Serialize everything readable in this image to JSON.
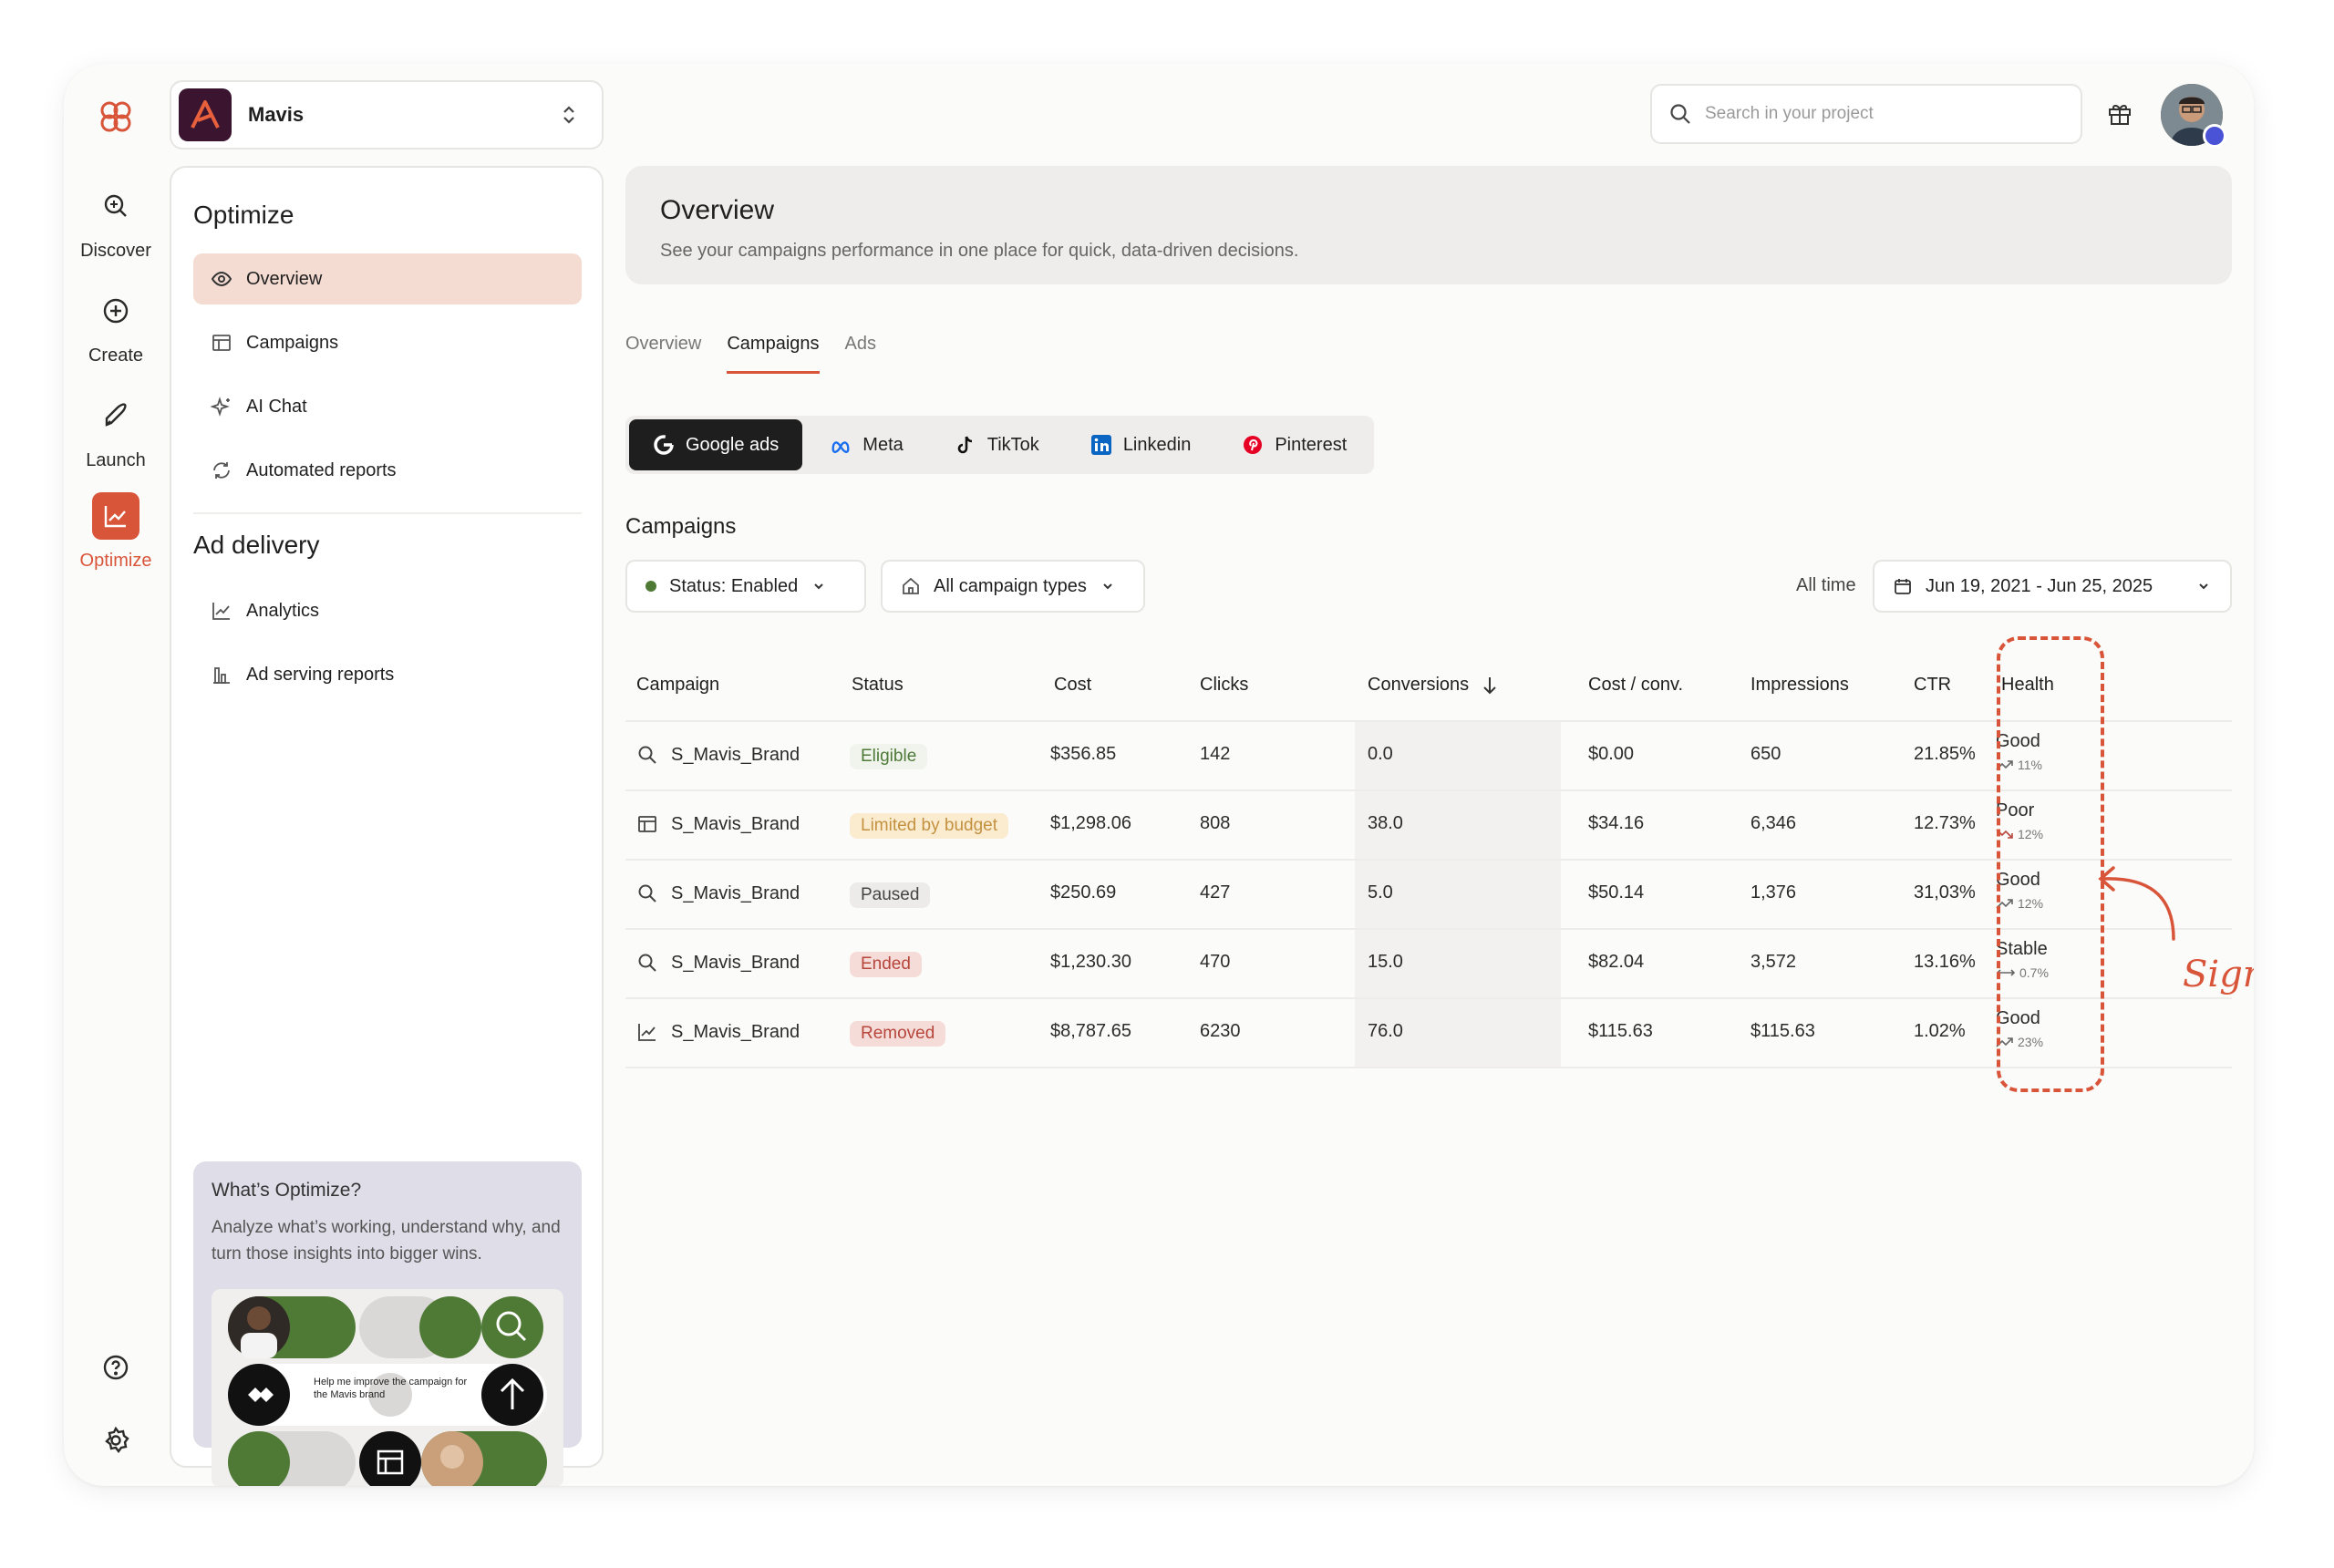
{
  "project": {
    "name": "Mavis"
  },
  "rail": {
    "items": [
      {
        "label": "Discover",
        "icon": "discover-icon"
      },
      {
        "label": "Create",
        "icon": "plus-circle-icon"
      },
      {
        "label": "Launch",
        "icon": "rocket-icon"
      },
      {
        "label": "Optimize",
        "icon": "chart-sparkle-icon",
        "active": true
      }
    ],
    "bottom_icons": [
      "help-icon",
      "settings-icon"
    ]
  },
  "sidebar": {
    "optimize_heading": "Optimize",
    "optimize_items": [
      {
        "label": "Overview",
        "icon": "eye-icon",
        "active": true
      },
      {
        "label": "Campaigns",
        "icon": "campaign-icon"
      },
      {
        "label": "AI Chat",
        "icon": "sparkle-icon"
      },
      {
        "label": "Automated reports",
        "icon": "report-icon"
      }
    ],
    "delivery_heading": "Ad delivery",
    "delivery_items": [
      {
        "label": "Analytics",
        "icon": "line-chart-icon"
      },
      {
        "label": "Ad serving reports",
        "icon": "bar-chart-icon"
      }
    ],
    "promo": {
      "title": "What’s Optimize?",
      "text": "Analyze what’s working, understand why, and turn those insights into bigger wins.",
      "chat_text": "Help me improve the campaign for the Mavis brand"
    }
  },
  "search": {
    "placeholder": "Search in your project"
  },
  "banner": {
    "title": "Overview",
    "subtitle": "See your campaigns performance in one place for quick, data-driven decisions."
  },
  "tabs": [
    {
      "label": "Overview"
    },
    {
      "label": "Campaigns",
      "active": true
    },
    {
      "label": "Ads"
    }
  ],
  "platforms": [
    {
      "label": "Google ads",
      "active": true
    },
    {
      "label": "Meta"
    },
    {
      "label": "TikTok"
    },
    {
      "label": "Linkedin"
    },
    {
      "label": "Pinterest"
    }
  ],
  "section_title": "Campaigns",
  "filters": {
    "status": "Status: Enabled",
    "types": "All campaign types",
    "time_label": "All time",
    "date_range": "Jun 19, 2021 - Jun 25, 2025"
  },
  "table": {
    "columns": [
      "Campaign",
      "Status",
      "Cost",
      "Clicks",
      "Conversions",
      "Cost / conv.",
      "Impressions",
      "CTR",
      "Health"
    ],
    "rows": [
      {
        "icon": "search-icon",
        "campaign": "S_Mavis_Brand",
        "status": "Eligible",
        "status_kind": "eligible",
        "cost": "$356.85",
        "clicks": "142",
        "conversions": "0.0",
        "cost_conv": "$0.00",
        "impressions": "650",
        "ctr": "21.85%",
        "health": "Good",
        "trend": "11%",
        "trend_dir": "up"
      },
      {
        "icon": "campaign-icon",
        "campaign": "S_Mavis_Brand",
        "status": "Limited by budget",
        "status_kind": "limited",
        "cost": "$1,298.06",
        "clicks": "808",
        "conversions": "38.0",
        "cost_conv": "$34.16",
        "impressions": "6,346",
        "ctr": "12.73%",
        "health": "Poor",
        "trend": "12%",
        "trend_dir": "down"
      },
      {
        "icon": "search-icon",
        "campaign": "S_Mavis_Brand",
        "status": "Paused",
        "status_kind": "paused",
        "cost": "$250.69",
        "clicks": "427",
        "conversions": "5.0",
        "cost_conv": "$50.14",
        "impressions": "1,376",
        "ctr": "31,03%",
        "health": "Good",
        "trend": "12%",
        "trend_dir": "up"
      },
      {
        "icon": "search-icon",
        "campaign": "S_Mavis_Brand",
        "status": "Ended",
        "status_kind": "ended",
        "cost": "$1,230.30",
        "clicks": "470",
        "conversions": "15.0",
        "cost_conv": "$82.04",
        "impressions": "3,572",
        "ctr": "13.16%",
        "health": "Stable",
        "trend": "0.7%",
        "trend_dir": "flat"
      },
      {
        "icon": "line-chart-icon",
        "campaign": "S_Mavis_Brand",
        "status": "Removed",
        "status_kind": "removed",
        "cost": "$8,787.65",
        "clicks": "6230",
        "conversions": "76.0",
        "cost_conv": "$115.63",
        "impressions": "$115.63",
        "ctr": "1.02%",
        "health": "Good",
        "trend": "23%",
        "trend_dir": "up"
      }
    ]
  },
  "annotation": "Signal",
  "colors": {
    "accent": "#d9553a",
    "active_nav": "#f5dcd3",
    "banner": "#eeedeb"
  }
}
